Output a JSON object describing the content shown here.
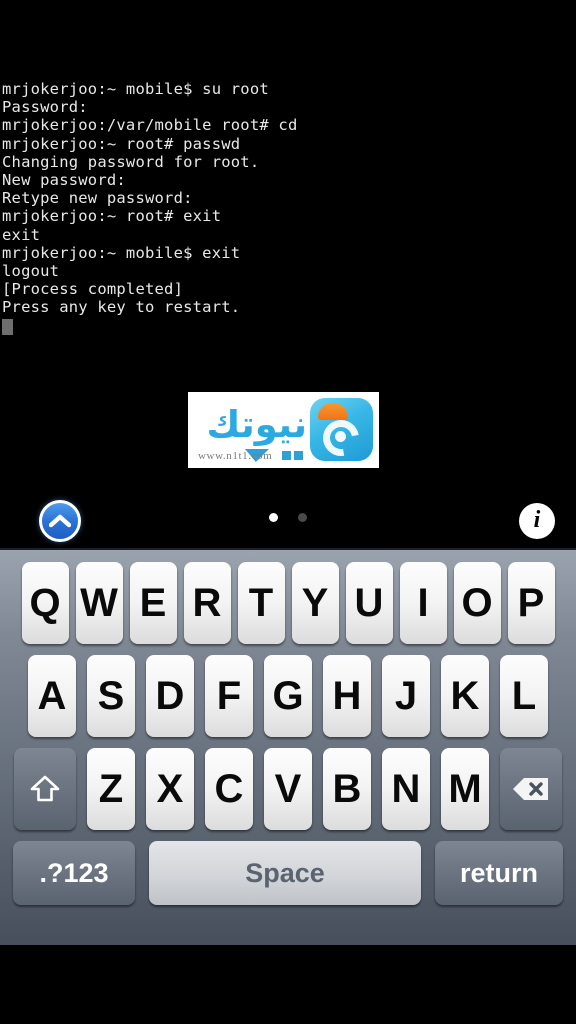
{
  "terminal": {
    "lines": [
      "mrjokerjoo:~ mobile$ su root",
      "Password:",
      "mrjokerjoo:/var/mobile root# cd",
      "mrjokerjoo:~ root# passwd",
      "Changing password for root.",
      "New password:",
      "Retype new password:",
      "mrjokerjoo:~ root# exit",
      "exit",
      "mrjokerjoo:~ mobile$ exit",
      "logout",
      "[Process completed]",
      "Press any key to restart."
    ],
    "text_color": "#e8e8e8",
    "background_color": "#000000",
    "cursor_color": "#6e6e6e"
  },
  "watermark": {
    "arabic_text": "نيوتك",
    "url": "www.n1t1.com",
    "brand_color": "#2ca9e0",
    "accent_color": "#f2711c",
    "background_color": "#ffffff"
  },
  "toolbar": {
    "nav_up_icon": "chevron-up-icon",
    "info_icon": "info-icon",
    "info_glyph": "i",
    "nav_up_color": "#2a72d6",
    "page_dots": [
      {
        "state": "active"
      },
      {
        "state": "inactive"
      }
    ]
  },
  "keyboard": {
    "rows": [
      {
        "id": "row-1",
        "keys": [
          {
            "label": "Q",
            "type": "letter"
          },
          {
            "label": "W",
            "type": "letter"
          },
          {
            "label": "E",
            "type": "letter"
          },
          {
            "label": "R",
            "type": "letter"
          },
          {
            "label": "T",
            "type": "letter"
          },
          {
            "label": "Y",
            "type": "letter"
          },
          {
            "label": "U",
            "type": "letter"
          },
          {
            "label": "I",
            "type": "letter"
          },
          {
            "label": "O",
            "type": "letter"
          },
          {
            "label": "P",
            "type": "letter"
          }
        ]
      },
      {
        "id": "row-2",
        "keys": [
          {
            "label": "A",
            "type": "letter"
          },
          {
            "label": "S",
            "type": "letter"
          },
          {
            "label": "D",
            "type": "letter"
          },
          {
            "label": "F",
            "type": "letter"
          },
          {
            "label": "G",
            "type": "letter"
          },
          {
            "label": "H",
            "type": "letter"
          },
          {
            "label": "J",
            "type": "letter"
          },
          {
            "label": "K",
            "type": "letter"
          },
          {
            "label": "L",
            "type": "letter"
          }
        ]
      },
      {
        "id": "row-3",
        "shift_icon": "shift-arrow-up-icon",
        "backspace_icon": "backspace-delete-icon",
        "keys": [
          {
            "label": "Z",
            "type": "letter"
          },
          {
            "label": "X",
            "type": "letter"
          },
          {
            "label": "C",
            "type": "letter"
          },
          {
            "label": "V",
            "type": "letter"
          },
          {
            "label": "B",
            "type": "letter"
          },
          {
            "label": "N",
            "type": "letter"
          },
          {
            "label": "M",
            "type": "letter"
          }
        ]
      },
      {
        "id": "row-4",
        "numbers_label": ".?123",
        "space_label": "Space",
        "return_label": "return"
      }
    ],
    "key_face_color": "#f3f3f3",
    "key_dark_color": "#6b7480",
    "background_color": "#7f8894"
  }
}
